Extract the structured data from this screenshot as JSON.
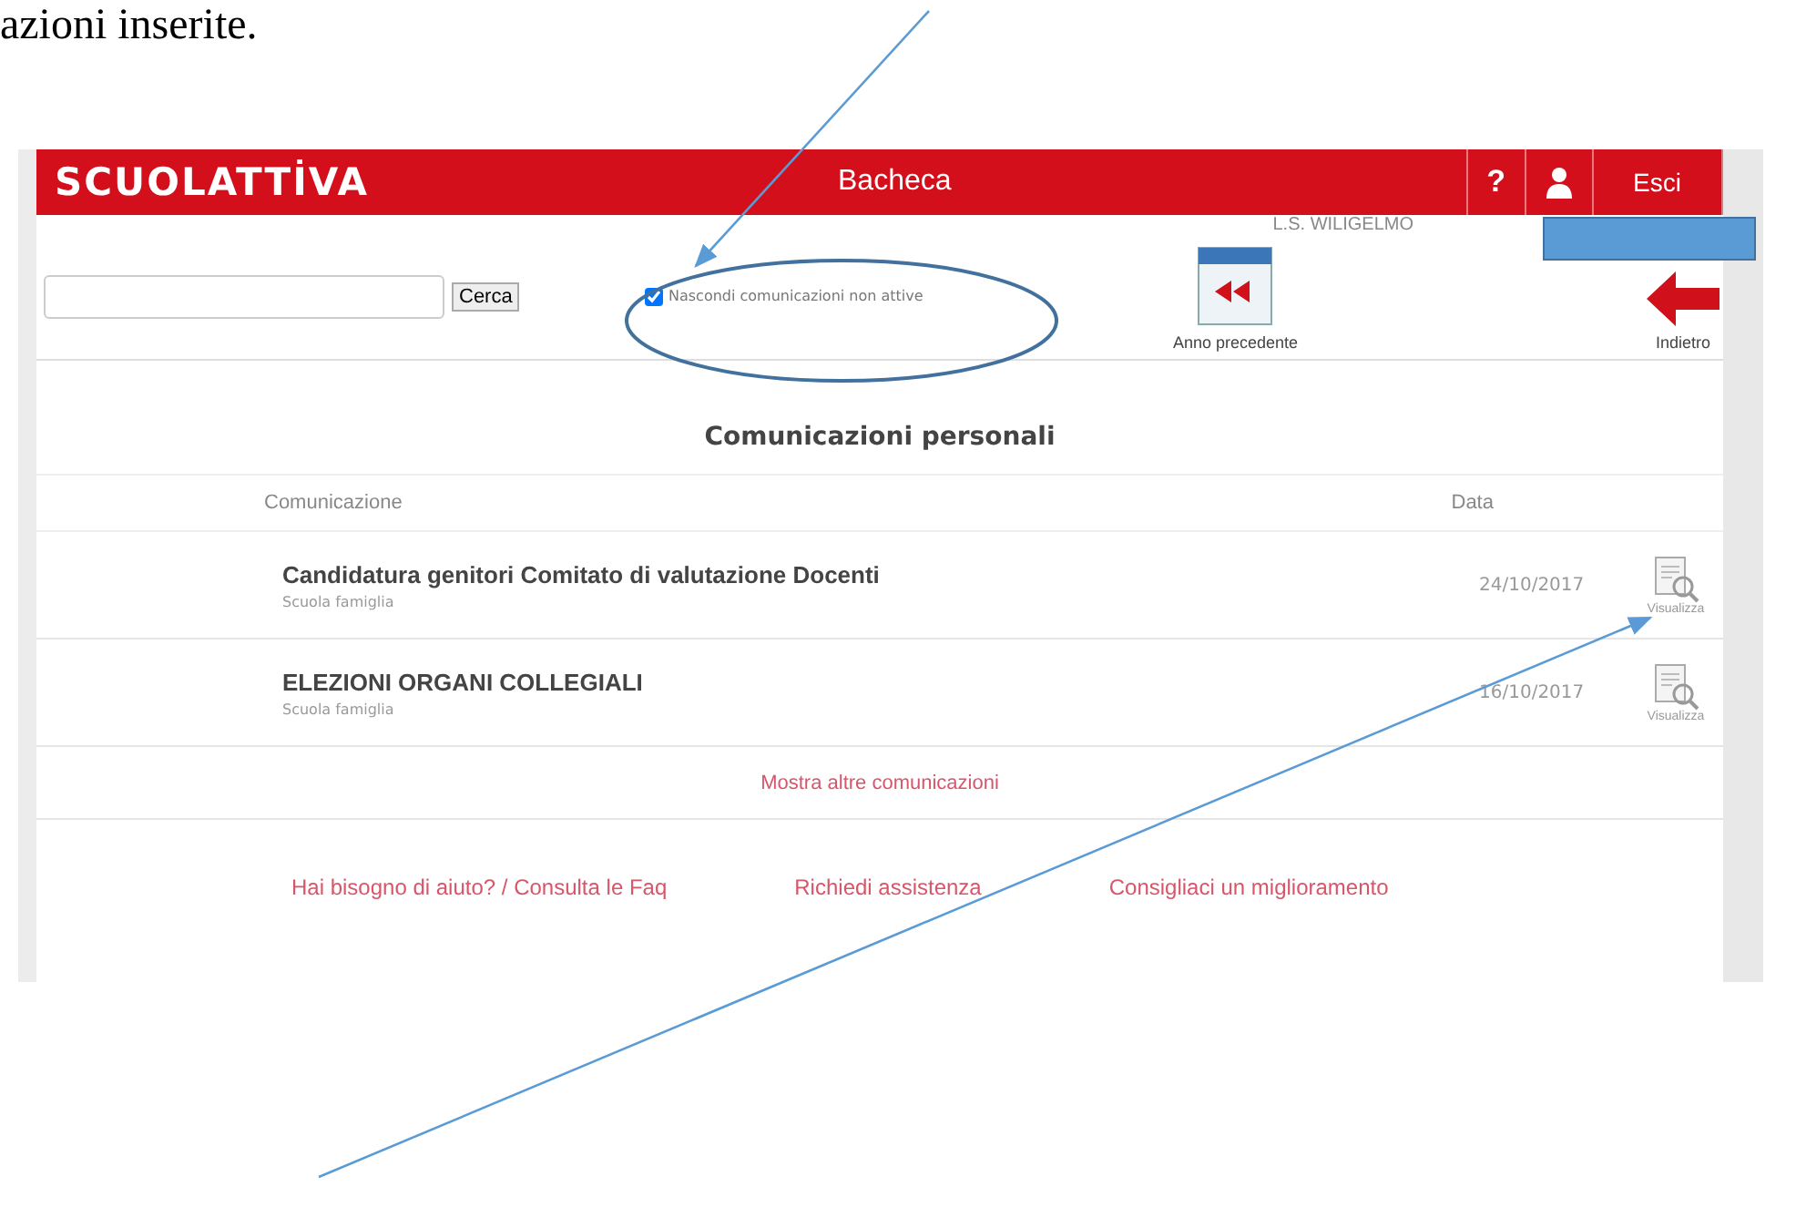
{
  "document_text": "azioni inserite.",
  "header": {
    "logo": "SCUOLATTİVA",
    "title": "Bacheca",
    "help": "?",
    "logout": "Esci"
  },
  "user": "L.S. WILIGELMO",
  "toolbar": {
    "search_button": "Cerca",
    "hide_inactive": {
      "label": "Nascondi comunicazioni non attive",
      "checked": true
    },
    "previous_year": "Anno precedente",
    "back": "Indietro"
  },
  "section_title": "Comunicazioni personali",
  "table": {
    "columns": [
      "Comunicazione",
      "Data"
    ],
    "rows": [
      {
        "title": "Candidatura genitori Comitato di valutazione Docenti",
        "source": "Scuola famiglia",
        "date": "24/10/2017",
        "action": "Visualizza"
      },
      {
        "title": "ELEZIONI ORGANI COLLEGIALI",
        "source": "Scuola famiglia",
        "date": "16/10/2017",
        "action": "Visualizza"
      }
    ]
  },
  "more": "Mostra altre comunicazioni",
  "footer_links": [
    "Hai bisogno di aiuto? / Consulta le Faq",
    "Richiedi assistenza",
    "Consigliaci un miglioramento"
  ]
}
